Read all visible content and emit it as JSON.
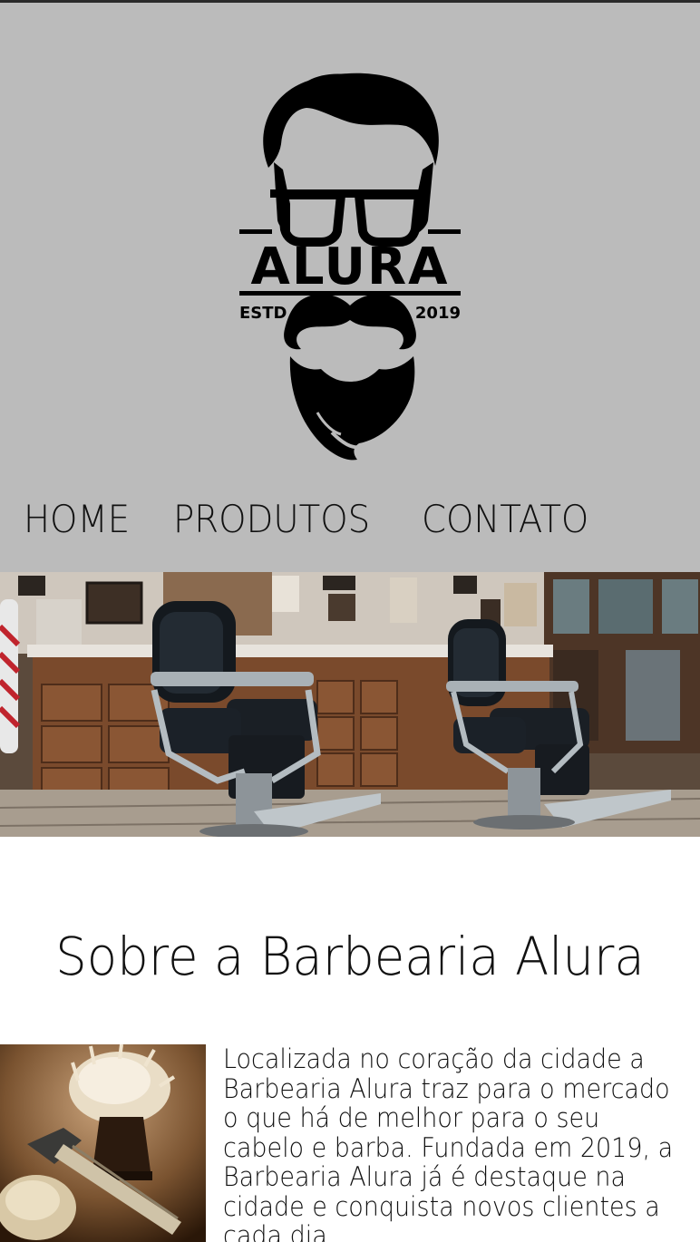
{
  "brand": {
    "logo_name": "ALURA",
    "logo_estd": "ESTD",
    "logo_year": "2019"
  },
  "nav": {
    "items": [
      {
        "label": "HOME"
      },
      {
        "label": "PRODUTOS"
      },
      {
        "label": "CONTATO"
      }
    ]
  },
  "about": {
    "title": "Sobre a Barbearia Alura",
    "text": "Localizada no coração da cidade a Barbearia Alura traz para o mercado o que há de melhor para o seu cabelo e barba. Fundada em 2019, a Barbearia Alura já é destaque na cidade e conquista novos clientes a cada dia."
  },
  "colors": {
    "header_bg": "#bbbbbb",
    "text": "#111111",
    "page_bg": "#ffffff"
  }
}
